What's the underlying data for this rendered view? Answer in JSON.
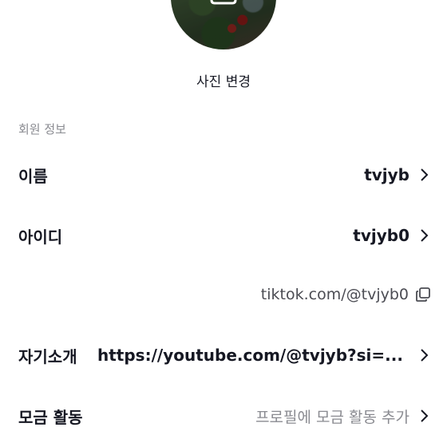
{
  "profile": {
    "change_photo_label": "사진 변경"
  },
  "section": {
    "title": "회원 정보"
  },
  "rows": {
    "name": {
      "label": "이름",
      "value": "tvjyb"
    },
    "username": {
      "label": "아이디",
      "value": "tvjyb0"
    },
    "profile_link": "tiktok.com/@tvjyb0",
    "bio": {
      "label": "자기소개",
      "value": "https://youtube.com/@tvjyb?si=..."
    },
    "fundraising": {
      "label": "모금 활동",
      "value": "프로필에 모금 활동 추가"
    }
  },
  "icons": {
    "camera": "camera-icon",
    "chevron": "chevron-right-icon",
    "copy": "copy-icon"
  },
  "colors": {
    "text_primary": "#161823",
    "text_secondary": "#8a8b91",
    "background": "#ffffff"
  }
}
